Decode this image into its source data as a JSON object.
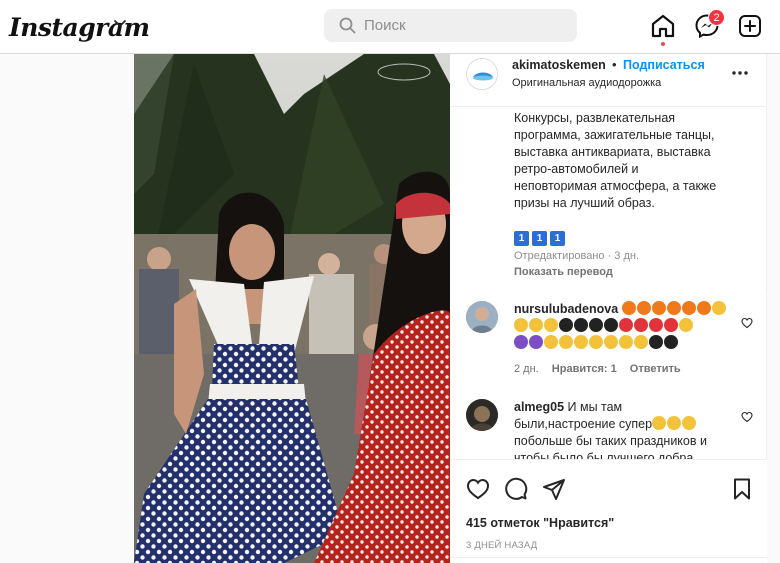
{
  "nav": {
    "logo": "Instagram",
    "search_placeholder": "Поиск",
    "messenger_badge": "2"
  },
  "post": {
    "author": "akimatoskemen",
    "separator": "•",
    "follow": "Подписаться",
    "audio": "Оригинальная аудиодорожка",
    "caption_lines": [
      "Конкурсы, развлекательная",
      "программа, зажигательные танцы,",
      "выставка антиквариата, выставка",
      "ретро-автомобилей и",
      "неповторимая атмосфера, а также",
      "призы на лучший образ."
    ],
    "keycaps": [
      "1",
      "1",
      "1"
    ],
    "edited": "Отредактировано · 3 дн.",
    "translate": "Показать перевод"
  },
  "comments": [
    {
      "user": "nursulubadenova",
      "time": "2 дн.",
      "likes": "Нравится: 1",
      "reply": "Ответить"
    },
    {
      "user": "almeg05",
      "text_lines": [
        "И мы там",
        "были,настроение супер",
        "побольше бы таких праздников и",
        "чтобы было бы лучшего добра"
      ]
    }
  ],
  "footer": {
    "likes": "415 отметок \"Нравится\"",
    "date": "3 ДНЕЙ НАЗАД"
  },
  "colors": {
    "link": "#0095f6",
    "badge": "#ff3040",
    "dress_navy": "#23306b",
    "dress_red": "#b5231f"
  }
}
